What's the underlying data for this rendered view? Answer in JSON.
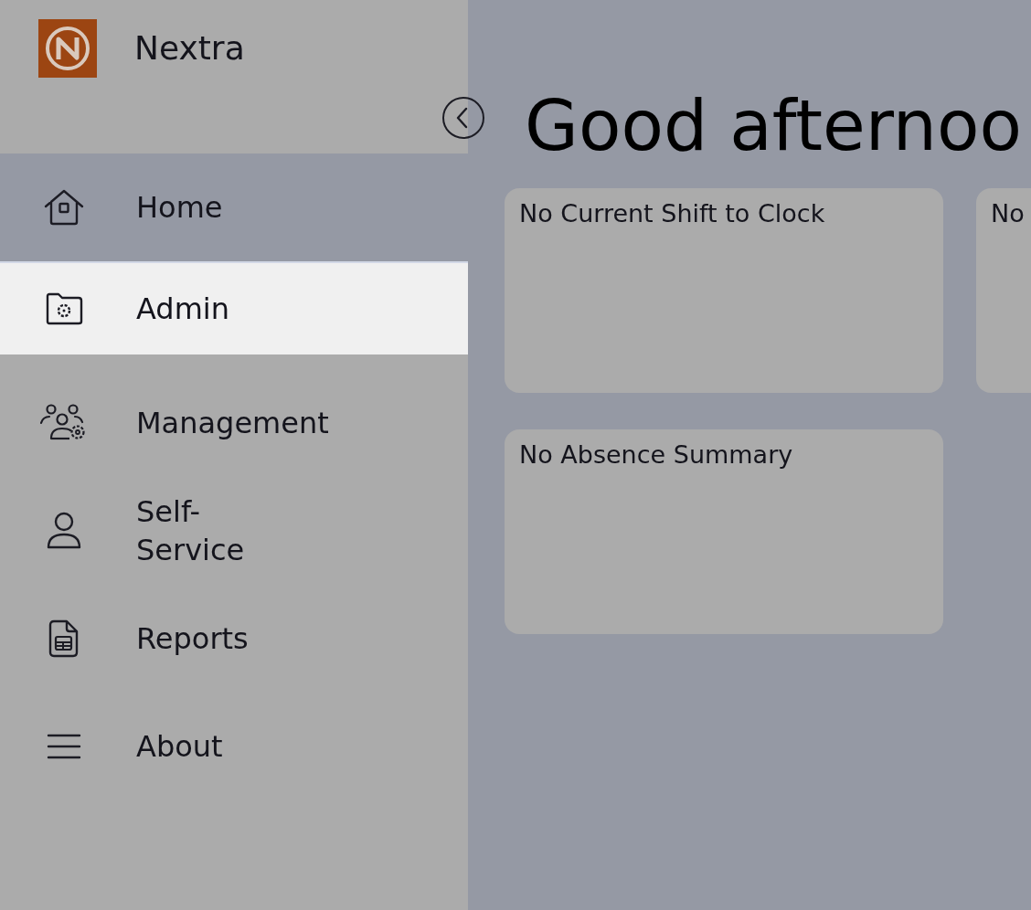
{
  "brand": {
    "name": "Nextra"
  },
  "nav": [
    {
      "label": "Home",
      "kind": "home",
      "selected": false,
      "hovered": true
    },
    {
      "label": "Admin",
      "kind": "admin",
      "selected": true,
      "hovered": false
    },
    {
      "label": "Management",
      "kind": "management",
      "selected": false,
      "hovered": false
    },
    {
      "label": "Self-\nService",
      "kind": "self",
      "selected": false,
      "hovered": false
    },
    {
      "label": "Reports",
      "kind": "reports",
      "selected": false,
      "hovered": false
    },
    {
      "label": "About",
      "kind": "about",
      "selected": false,
      "hovered": false
    }
  ],
  "greeting": "Good afternoo",
  "cards": [
    {
      "title": "No Current Shift to Clock"
    },
    {
      "title": "No"
    },
    {
      "title": "No Absence Summary"
    }
  ]
}
